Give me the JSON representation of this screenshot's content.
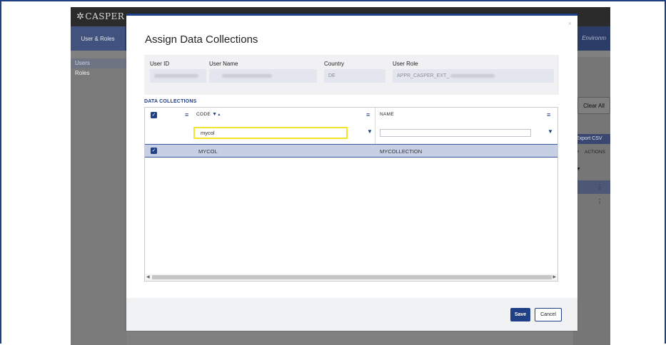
{
  "app": {
    "logo": "CASPER",
    "nav_tab": "User & Roles",
    "nav_right": "Environm",
    "sidebar": [
      "Users",
      "Roles"
    ],
    "clear_all": "Clear All",
    "export_csv": "Export CSV",
    "actions_header": "ACTIONS",
    "row_menu": "⋮"
  },
  "modal": {
    "title": "Assign Data Collections",
    "close": "×",
    "info": {
      "user_id_label": "User ID",
      "user_name_label": "User Name",
      "country_label": "Country",
      "country_value": "DE",
      "user_role_label": "User Role",
      "user_role_value": "APPR_CASPER_EXT_"
    },
    "section_label": "DATA COLLECTIONS",
    "grid": {
      "col_code": "CODE",
      "col_name": "NAME",
      "code_filter": "mycol",
      "name_filter": "",
      "sort_indicator": "▲",
      "rows": [
        {
          "code": "MYCOL",
          "name": "MYCOLLECTION",
          "checked": true
        }
      ]
    },
    "save_label": "Save",
    "cancel_label": "Cancel"
  },
  "colors": {
    "primary": "#1f3f86",
    "highlight": "#f2e52a",
    "selected_row": "#c6cfe3"
  },
  "icons": [
    "checkbox-icon",
    "column-menu-icon",
    "filter-icon",
    "close-icon",
    "scroll-left-icon",
    "scroll-right-icon"
  ]
}
